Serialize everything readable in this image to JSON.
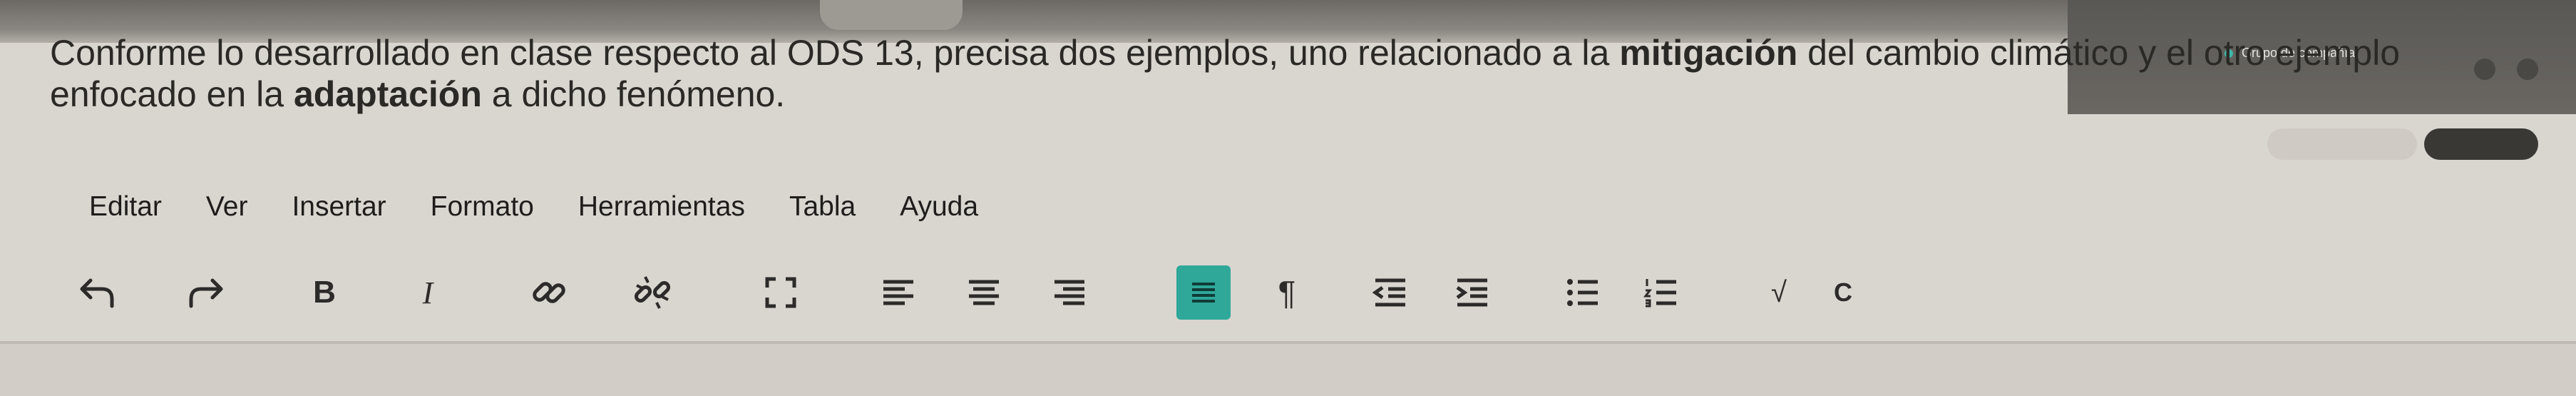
{
  "question": {
    "part1": "Conforme lo desarrollado en clase respecto al ODS 13, precisa dos ejemplos, uno relacionado a la ",
    "bold1": "mitigación",
    "part2": " del cambio climático y el otro ejemplo",
    "part3": "enfocado en la ",
    "bold2": "adaptación",
    "part4": " a dicho fenómeno."
  },
  "menu": [
    "Editar",
    "Ver",
    "Insertar",
    "Formato",
    "Herramientas",
    "Tabla",
    "Ayuda"
  ],
  "toolbar": {
    "undo": "undo-icon",
    "redo": "redo-icon",
    "bold": "B",
    "italic": "I",
    "highlight": "C"
  },
  "topright": {
    "share_label": "Grupo de compañía"
  },
  "colors": {
    "accent": "#3fb6a8",
    "background": "#d9d5cf"
  }
}
